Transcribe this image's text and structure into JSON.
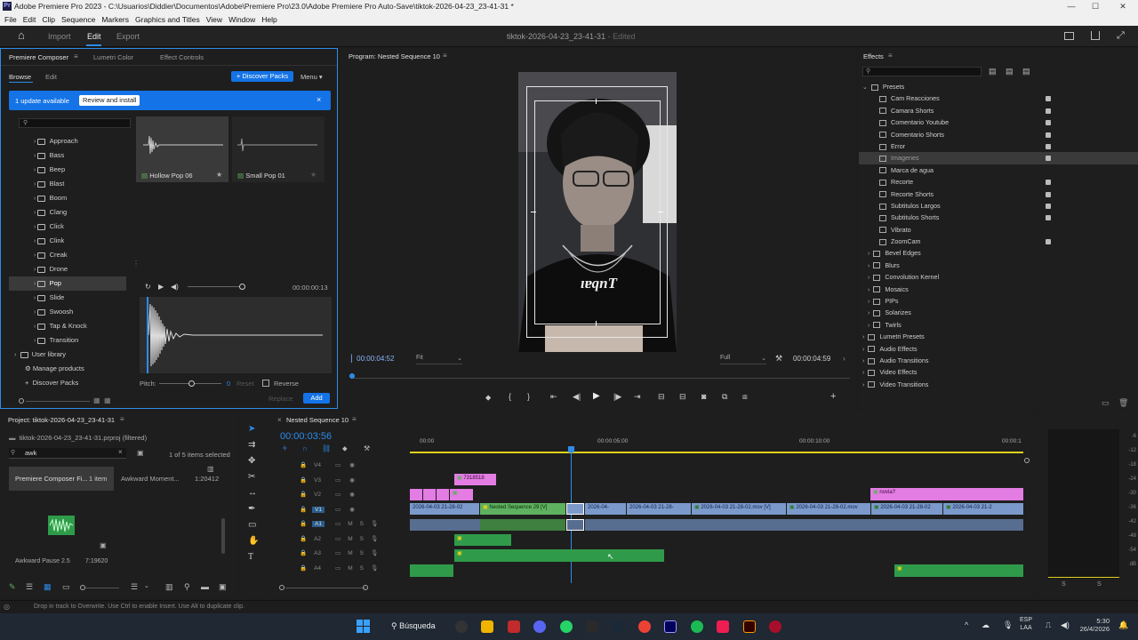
{
  "window": {
    "title": "Adobe Premiere Pro 2023 - C:\\Usuarios\\Diddier\\Documentos\\Adobe\\Premiere Pro\\23.0\\Adobe Premiere Pro Auto-Save\\tiktok-2026-04-23_23-41-31 *",
    "app_icon": "Pr",
    "min": "—",
    "max": "☐",
    "close": "✕"
  },
  "menu": [
    "File",
    "Edit",
    "Clip",
    "Sequence",
    "Markers",
    "Graphics and Titles",
    "View",
    "Window",
    "Help"
  ],
  "topbar": {
    "home": "⌂",
    "workspaces": [
      "Import",
      "Edit",
      "Export"
    ],
    "project_name": "tiktok-2026-04-23_23-41-31",
    "edited": "- Edited"
  },
  "left_panel": {
    "tabs": [
      "Premiere Composer",
      "Lumetri Color",
      "Effect Controls"
    ],
    "subtabs": [
      "Browse",
      "Edit"
    ],
    "discover_packs": "+ Discover Packs",
    "menu": "Menu",
    "update": {
      "text": "1 update available",
      "button": "Review and install",
      "close": "×"
    },
    "folders": [
      "Approach",
      "Bass",
      "Beep",
      "Blast",
      "Boom",
      "Clang",
      "Click",
      "Clink",
      "Creak",
      "Drone",
      "Pop",
      "Slide",
      "Swoosh",
      "Tap & Knock",
      "Transition"
    ],
    "selected_folder": "Pop",
    "user_library": "User library",
    "manage_products": "Manage products",
    "discover_packs_link": "Discover Packs",
    "assets": [
      "Hollow Pop 06",
      "Small Pop 01"
    ],
    "player_time": "00:00:00:13",
    "pitch_label": "Pitch:",
    "pitch_value": "0",
    "reset": "Reset",
    "reverse": "Reverse",
    "replace": "Replace",
    "add": "Add"
  },
  "program": {
    "title": "Program: Nested Sequence 10",
    "timecode_left": "00:00:04:52",
    "fit": "Fit",
    "quality": "Full",
    "timecode_right": "00:00:04:59",
    "shirt_text": "ıɐqnT"
  },
  "effects": {
    "title": "Effects",
    "presets_label": "Presets",
    "presets": [
      "Cam Reacciones",
      "Camara Shorts",
      "Comentario Youtube",
      "Comentario Shorts",
      "Error",
      "Imagenes",
      "Marca de agua",
      "Recorte",
      "Recorte Shorts",
      "Subtitulos Largos",
      "Subtitulos Shorts",
      "Vibrato",
      "ZoomCam"
    ],
    "preset_folders": [
      "Bevel Edges",
      "Blurs",
      "Convolution Kernel",
      "Mosaics",
      "PIPs",
      "Solarizes",
      "Twirls"
    ],
    "groups": [
      "Lumetri Presets",
      "Audio Effects",
      "Audio Transitions",
      "Video Effects",
      "Video Transitions"
    ],
    "selected": "Imagenes"
  },
  "project": {
    "title": "Project: tiktok-2026-04-23_23-41-31",
    "file": "tiktok-2026-04-23_23-41-31.prproj (filtered)",
    "search": "awk",
    "selection": "1 of 5 items selected",
    "items": [
      {
        "name": "Premiere Composer Fi...",
        "meta": "1 item"
      },
      {
        "name": "Awkward Moment...",
        "meta": "1:20412"
      },
      {
        "name": "Awkward Pause 2.5",
        "meta": "7:19620"
      }
    ]
  },
  "timeline": {
    "title": "Nested Sequence 10",
    "timecode": "00:00:03:56",
    "ruler": [
      "00:00",
      "00:00:05:00",
      "00:00:10:00",
      "00:00:1"
    ],
    "tracks": [
      "V4",
      "V3",
      "V2",
      "V1",
      "A1",
      "A2",
      "A3",
      "A4"
    ],
    "clips": {
      "pink_top": "7318518",
      "pink_right": "novia?",
      "v1": [
        "2026-04-03 21-28-02",
        "Nested Sequence 29 [V]",
        "2026-04-",
        "2026-04-03 21-28-",
        "2026-04-03 21-28-02.mov [V]",
        "2026-04-03 21-28-02.mov",
        "2026-04-03 21-28-02",
        "2026-04-03 21-2"
      ]
    }
  },
  "meters": {
    "labels": [
      "-6",
      "-12",
      "-18",
      "-24",
      "-30",
      "-36",
      "-42",
      "-48",
      "-54",
      "dB"
    ],
    "solo": [
      "S",
      "S"
    ]
  },
  "status": "Drop in track to Overwrite. Use Ctrl to enable Insert. Use Alt to duplicate clip.",
  "taskbar": {
    "search": "Búsqueda",
    "lang": "ESP\nLAA",
    "time": "5:30",
    "date": "26/4/2026"
  }
}
